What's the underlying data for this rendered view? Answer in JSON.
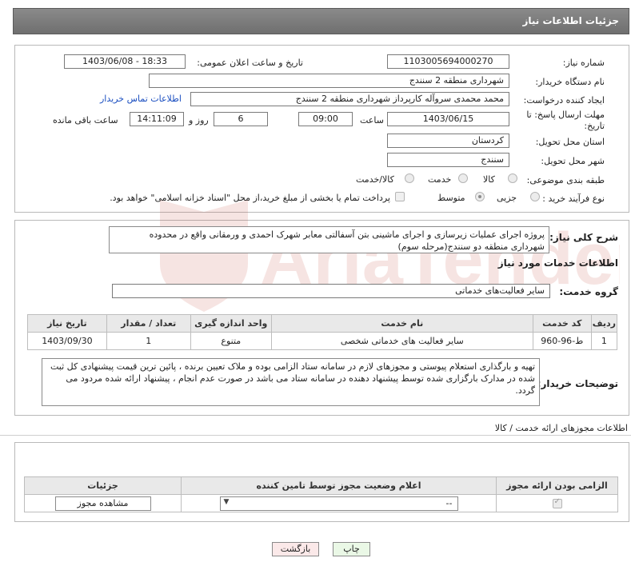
{
  "header": {
    "title": "جزئیات اطلاعات نیاز"
  },
  "labels": {
    "need_number": "شماره نیاز:",
    "announce_datetime": "تاریخ و ساعت اعلان عمومی:",
    "buyer_org": "نام دستگاه خریدار:",
    "requester": "ایجاد کننده درخواست:",
    "deadline": "مهلت ارسال پاسخ: تا تاریخ:",
    "time_word": "ساعت",
    "day_and": "روز و",
    "remaining": "ساعت باقی مانده",
    "province": "استان محل تحویل:",
    "city": "شهر محل تحویل:",
    "category": "طبقه بندی موضوعی:",
    "process_type": "نوع فرآیند خرید :",
    "general_desc": "شرح کلی نیاز:",
    "services_info": "اطلاعات خدمات مورد نیاز",
    "service_group": "گروه خدمت:",
    "buyer_notes": "توضیحات خریدار:",
    "permits_section": "اطلاعات مجوزهای ارائه خدمت / کالا"
  },
  "values": {
    "need_number": "1103005694000270",
    "announce_datetime": "1403/06/08 - 18:33",
    "buyer_org": "شهرداری منطقه 2 سنندج",
    "requester": "محمد محمدی سروآله کارپرداز شهرداری منطقه 2 سنندج",
    "contact_link": "اطلاعات تماس خریدار",
    "deadline_date": "1403/06/15",
    "deadline_time": "09:00",
    "days_left": "6",
    "time_left": "14:11:09",
    "province": "کردستان",
    "city": "سنندج",
    "general_desc": "پروژه اجرای عملیات زیرسازی و اجرای ماشینی بتن آسفالتی معابر شهرک احمدی و ورمقانی واقع در محدوده شهرداری منطقه دو سنندج(مرحله سوم)",
    "service_group": "سایر فعالیت‌های خدماتی",
    "buyer_notes": "تهیه و بارگذاری استعلام پیوستی و مجوزهای لازم در سامانه ستاد الزامی بوده و ملاک تعیین برنده ، پائین ترین قیمت پیشنهادی کل ثبت شده در مدارک بارگزاری شده توسط پیشنهاد دهنده در سامانه ستاد می باشد در صورت عدم انجام ، پیشنهاد ارائه شده مردود می گردد."
  },
  "category_options": [
    {
      "label": "کالا",
      "checked": false
    },
    {
      "label": "خدمت",
      "checked": false
    },
    {
      "label": "کالا/خدمت",
      "checked": false
    }
  ],
  "process_options": [
    {
      "label": "جزیی",
      "checked": false
    },
    {
      "label": "متوسط",
      "checked": true
    }
  ],
  "payment_note": "پرداخت تمام یا بخشی از مبلغ خرید،از محل \"اسناد خزانه اسلامی\" خواهد بود.",
  "services_table": {
    "headers": [
      "ردیف",
      "کد خدمت",
      "نام خدمت",
      "واحد اندازه گیری",
      "تعداد / مقدار",
      "تاریخ نیاز"
    ],
    "rows": [
      [
        "1",
        "ط-96-960",
        "سایر فعالیت های خدماتی شخصی",
        "متنوع",
        "1",
        "1403/09/30"
      ]
    ]
  },
  "permits_table": {
    "headers": [
      "الزامی بودن ارائه مجوز",
      "اعلام وضعیت مجوز توسط تامین کننده",
      "جزئیات"
    ],
    "select_value": "--",
    "details_button": "مشاهده مجوز"
  },
  "buttons": {
    "print": "چاپ",
    "back": "بازگشت"
  },
  "watermark_text": "AriaTender.neT"
}
